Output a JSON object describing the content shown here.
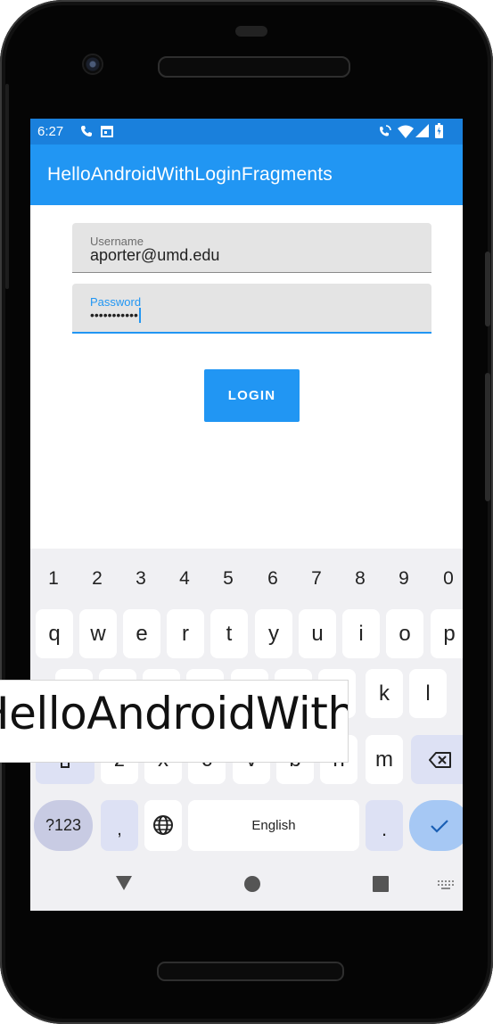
{
  "status": {
    "time": "6:27",
    "icons": [
      "phone-call-icon",
      "calendar-icon",
      "wifi-calling-icon",
      "wifi-icon",
      "signal-icon",
      "battery-icon"
    ]
  },
  "app": {
    "title": "HelloAndroidWithLoginFragments",
    "bar_color": "#2196F3",
    "status_color": "#1A80DC"
  },
  "form": {
    "username_label": "Username",
    "username_value": "aporter@umd.edu",
    "password_label": "Password",
    "password_value": "•••••••••••",
    "login_label": "LOGIN"
  },
  "keyboard": {
    "number_row": [
      "1",
      "2",
      "3",
      "4",
      "5",
      "6",
      "7",
      "8",
      "9",
      "0"
    ],
    "row1": [
      "q",
      "w",
      "e",
      "r",
      "t",
      "y",
      "u",
      "i",
      "o",
      "p"
    ],
    "row2_visible": [
      "k",
      "l"
    ],
    "row3_visible": [
      "z",
      "x",
      "c",
      "v",
      "b",
      "n",
      "m"
    ],
    "symbols_label": "?123",
    "comma_label": ",",
    "space_label": "English",
    "period_label": "."
  },
  "overlay": {
    "caption": "HelloAndroidWithFragments"
  }
}
